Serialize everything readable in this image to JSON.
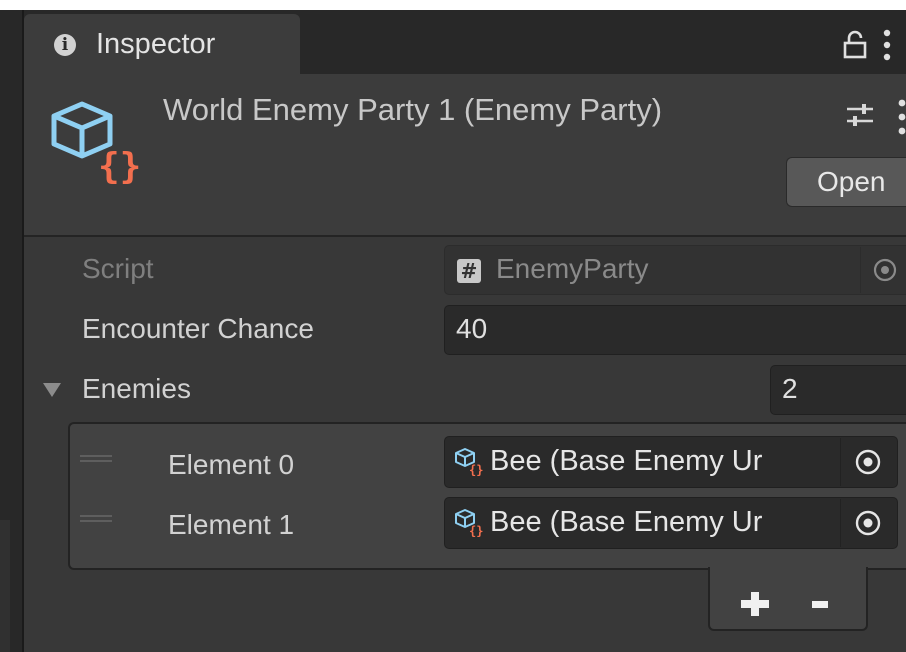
{
  "window": {
    "tab_label": "Inspector"
  },
  "header": {
    "title": "World Enemy Party 1 (Enemy Party)",
    "open_button": "Open"
  },
  "properties": {
    "script": {
      "label": "Script",
      "value": "EnemyParty"
    },
    "encounter_chance": {
      "label": "Encounter Chance",
      "value": "40"
    },
    "enemies": {
      "label": "Enemies",
      "size": "2",
      "elements": [
        {
          "label": "Element 0",
          "value": "Bee (Base Enemy Ur"
        },
        {
          "label": "Element 1",
          "value": "Bee (Base Enemy Ur"
        }
      ],
      "add_button": "+",
      "remove_button": "-"
    }
  },
  "icons": {
    "tab": "info-icon",
    "lock": "lock-icon",
    "menu": "kebab-menu-icon",
    "asset": "scriptable-object-icon",
    "settings": "sliders-icon",
    "script": "csharp-script-icon",
    "target": "object-picker-icon",
    "foldout": "foldout-expanded-icon",
    "drag": "drag-handle-icon"
  },
  "colors": {
    "panel_bg": "#383838",
    "header_bg": "#3c3c3c",
    "field_bg": "#2a2a2a",
    "icon_blue": "#8fd0f2",
    "icon_orange": "#f36f4e"
  }
}
